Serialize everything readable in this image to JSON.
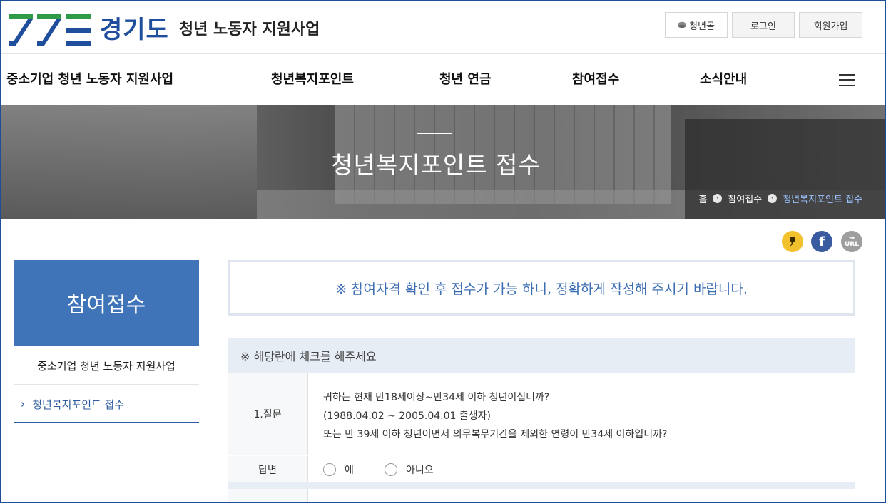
{
  "header": {
    "brand": "경기도",
    "site_title": "청년 노동자 지원사업",
    "utility": {
      "shop_icon": "coin-icon",
      "shop": "청년몰",
      "login": "로그인",
      "join": "회원가입"
    }
  },
  "gnb": {
    "items": [
      "중소기업 청년 노동자 지원사업",
      "청년복지포인트",
      "청년 연금",
      "참여접수",
      "소식안내"
    ],
    "menu_icon": "hamburger-icon"
  },
  "banner": {
    "title": "청년복지포인트 접수",
    "breadcrumb": [
      "홈",
      "참여접수",
      "청년복지포인트 접수"
    ]
  },
  "share": {
    "kakao_icon": "kakao-icon",
    "facebook_glyph": "f",
    "url_label": "URL"
  },
  "lnb": {
    "title": "참여접수",
    "sub": "중소기업 청년 노동자 지원사업",
    "items": [
      {
        "label": "청년복지포인트 접수",
        "active": true
      }
    ]
  },
  "notice": "※ 참여자격 확인 후 접수가 가능 하니, 정확하게 작성해 주시기 바랍니다.",
  "survey": {
    "heading": "※ 해당란에 체크를 해주세요",
    "question_label": "1.질문",
    "question_lines": [
      "귀하는 현재 만18세이상~만34세 이하 청년이십니까?",
      "(1988.04.02 ~ 2005.04.01 출생자)",
      "또는 만 39세 이하 청년이면서 의무복무기간을 제외한 연령이 만34세 이하입니까?"
    ],
    "answer_label": "답변",
    "options": [
      "예",
      "아니오"
    ]
  },
  "colors": {
    "primary": "#3f74b9",
    "brand_text": "#1f4e9c",
    "logo_green": "#2f9a48",
    "logo_blue": "#1f4e9c",
    "notice_text": "#3b6db3",
    "table_header_bg": "#e6edf5"
  }
}
